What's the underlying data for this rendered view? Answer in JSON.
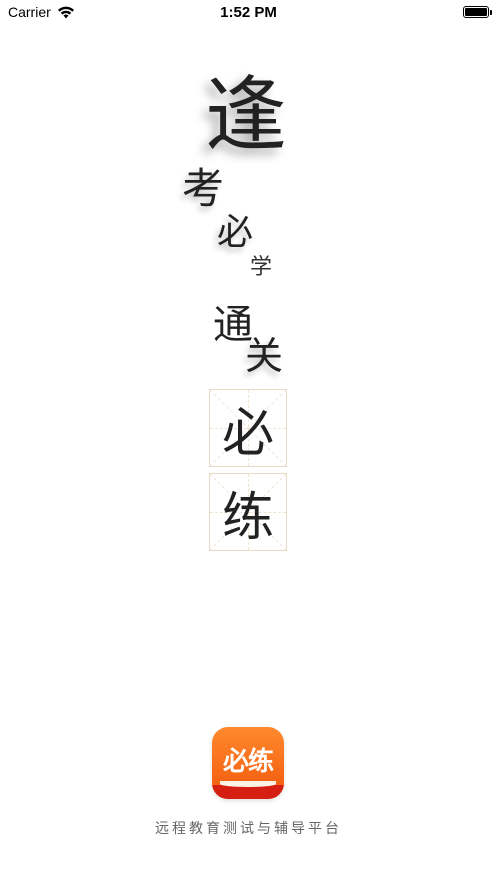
{
  "status_bar": {
    "carrier": "Carrier",
    "time": "1:52 PM",
    "battery_level": 1.0
  },
  "slogan": {
    "line1": "逢",
    "line2": "考",
    "line3": "必",
    "line4": "学",
    "line5": "通",
    "line6": "关"
  },
  "mizige": {
    "char1": "必",
    "char2": "练"
  },
  "app_icon": {
    "label": "必练",
    "color_top": "#ff8a2e",
    "color_bottom": "#d61f13"
  },
  "tagline": "远程教育测试与辅导平台",
  "icons": {
    "wifi": "wifi-icon",
    "battery": "battery-icon"
  }
}
